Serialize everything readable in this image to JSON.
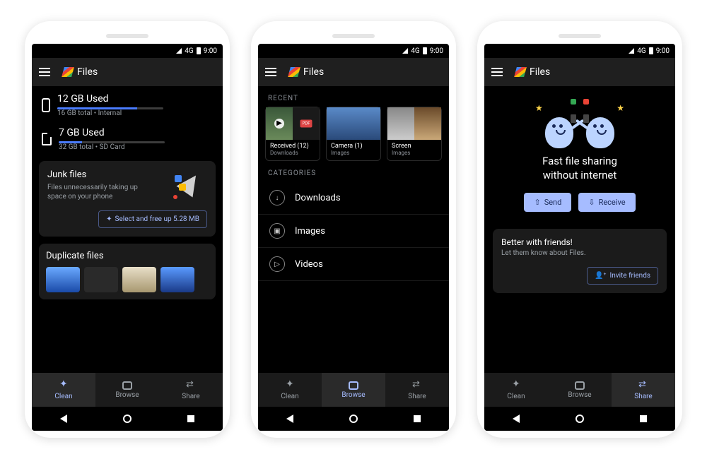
{
  "status": {
    "network": "4G",
    "time": "9:00"
  },
  "app": {
    "title": "Files"
  },
  "tabs": {
    "clean": "Clean",
    "browse": "Browse",
    "share": "Share"
  },
  "screen1": {
    "storage": [
      {
        "used": "12 GB Used",
        "sub": "16 GB total • Internal",
        "pct": 75
      },
      {
        "used": "7 GB Used",
        "sub": "32 GB total • SD Card",
        "pct": 22
      }
    ],
    "junk": {
      "title": "Junk files",
      "sub": "Files unnecessarily taking up space on your phone",
      "action": "Select and free up 5.28 MB"
    },
    "dup": {
      "title": "Duplicate files"
    }
  },
  "screen2": {
    "recent_label": "RECENT",
    "recent": [
      {
        "title": "Received (12)",
        "sub": "Downloads"
      },
      {
        "title": "Camera (1)",
        "sub": "Images"
      },
      {
        "title": "Screen",
        "sub": "Images"
      }
    ],
    "categories_label": "CATEGORIES",
    "categories": [
      {
        "label": "Downloads",
        "glyph": "↓"
      },
      {
        "label": "Images",
        "glyph": "▣"
      },
      {
        "label": "Videos",
        "glyph": "▷"
      }
    ]
  },
  "screen3": {
    "hero_line1": "Fast file sharing",
    "hero_line2": "without internet",
    "send": "Send",
    "receive": "Receive",
    "card_title": "Better with friends!",
    "card_sub": "Let them know about Files.",
    "invite": "Invite friends"
  }
}
